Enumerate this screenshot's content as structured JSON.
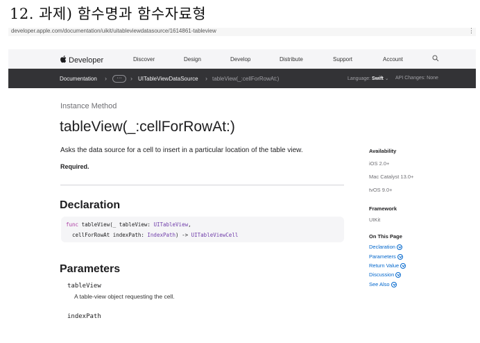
{
  "doc_heading": "12. 과제) 함수명과 함수자료형",
  "url": "developer.apple.com/documentation/uikit/uitableviewdatasource/1614861-tableview",
  "nav": {
    "brand": "Developer",
    "links": [
      "Discover",
      "Design",
      "Develop",
      "Distribute",
      "Support",
      "Account"
    ]
  },
  "localnav": {
    "documentation": "Documentation",
    "more": "···",
    "datasource": "UITableViewDataSource",
    "current": "tableView(_:cellForRowAt:)",
    "language_label": "Language:",
    "language_value": "Swift",
    "api_label": "API Changes:",
    "api_value": "None"
  },
  "main": {
    "eyebrow": "Instance Method",
    "title": "tableView(_:cellForRowAt:)",
    "abstract": "Asks the data source for a cell to insert in a particular location of the table view.",
    "required": "Required.",
    "declaration_heading": "Declaration",
    "code": {
      "kw_func": "func",
      "sig_1": " tableView(_ tableView: ",
      "type_1": "UITableView",
      "comma": ",",
      "sig_2": "  cellForRowAt indexPath: ",
      "type_2": "IndexPath",
      "arrow": ") -> ",
      "type_3": "UITableViewCell"
    },
    "parameters_heading": "Parameters",
    "params": [
      {
        "name": "tableView",
        "desc": "A table-view object requesting the cell."
      },
      {
        "name": "indexPath",
        "desc": ""
      }
    ]
  },
  "sidebar": {
    "availability_heading": "Availability",
    "availability": [
      "iOS 2.0+",
      "Mac Catalyst 13.0+",
      "tvOS 9.0+"
    ],
    "framework_heading": "Framework",
    "framework": "UIKit",
    "on_this_page_heading": "On This Page",
    "on_this_page": [
      "Declaration",
      "Parameters",
      "Return Value",
      "Discussion",
      "See Also"
    ]
  },
  "colors": {
    "link": "#0066cc",
    "keyword": "#ad3da4",
    "type": "#703daa",
    "localnav_bg": "#333336",
    "globalnav_bg": "#f5f5f7"
  }
}
